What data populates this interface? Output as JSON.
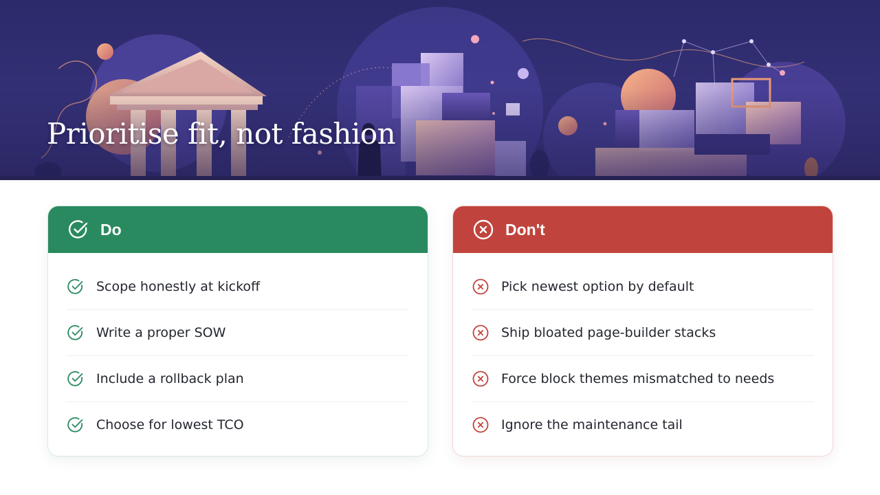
{
  "slide": {
    "title": "Prioritise fit, not fashion",
    "colors": {
      "do": "#2a8a5f",
      "dont": "#c0443d",
      "hero_bg": "#2f2b6b"
    }
  },
  "do_panel": {
    "heading": "Do",
    "icon": "check-circle-icon",
    "items": [
      "Scope honestly at kickoff",
      "Write a proper SOW",
      "Include a rollback plan",
      "Choose for lowest TCO"
    ]
  },
  "dont_panel": {
    "heading": "Don't",
    "icon": "x-circle-icon",
    "items": [
      "Pick newest option by default",
      "Ship bloated page-builder stacks",
      "Force block themes mismatched to needs",
      "Ignore the maintenance tail"
    ]
  }
}
